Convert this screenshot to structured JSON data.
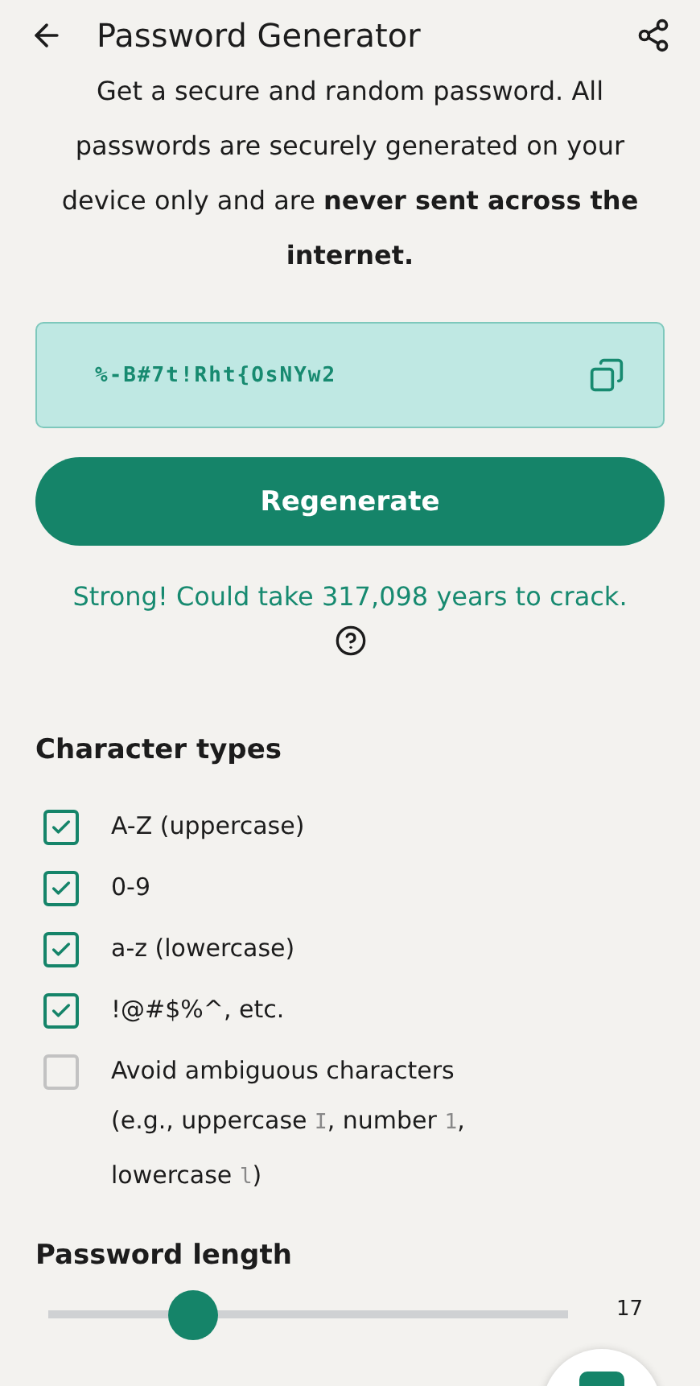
{
  "header": {
    "title": "Password Generator"
  },
  "intro": "Get a secure and random password. All passwords are securely generated on your device only and are **never sent across the internet.**",
  "password": {
    "value": "%-B#7t!Rht{OsNYw2"
  },
  "regenerate_button": "Regenerate",
  "strength": "Strong! Could take 317,098 years to crack.",
  "character_types": {
    "title": "Character types",
    "options": [
      {
        "kind": "plain",
        "label": "A-Z (uppercase)",
        "checked": true
      },
      {
        "kind": "plain",
        "label": "0-9",
        "checked": true
      },
      {
        "kind": "plain",
        "label": "a-z (lowercase)",
        "checked": true
      },
      {
        "kind": "plain",
        "label": "!@#$%^, etc.",
        "checked": true
      },
      {
        "kind": "detailed",
        "label": "Avoid ambiguous characters",
        "checked": false,
        "details": [
          {
            "kind": "text",
            "text": "(e.g., uppercase "
          },
          {
            "kind": "code",
            "text": "I"
          },
          {
            "kind": "text",
            "text": ", number "
          },
          {
            "kind": "code",
            "text": "1"
          },
          {
            "kind": "text",
            "text": ", lowercase "
          },
          {
            "kind": "code",
            "text": "l"
          },
          {
            "kind": "text",
            "text": ")"
          }
        ]
      }
    ]
  },
  "password_length": {
    "title": "Password length",
    "level": 0.28,
    "value": "17"
  }
}
